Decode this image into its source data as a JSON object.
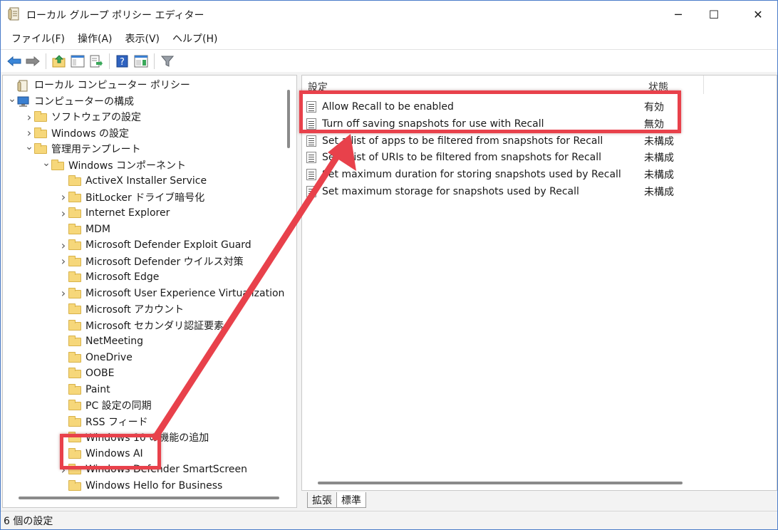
{
  "window": {
    "title": "ローカル グループ ポリシー エディター",
    "controls": {
      "minimize": "─",
      "maximize": "☐",
      "close": "✕"
    }
  },
  "menubar": [
    "ファイル(F)",
    "操作(A)",
    "表示(V)",
    "ヘルプ(H)"
  ],
  "toolbar": [
    "back-arrow-icon",
    "forward-arrow-icon",
    "up-folder-icon",
    "show-hide-tree-icon",
    "export-list-icon",
    "help-icon",
    "properties-icon",
    "filter-icon"
  ],
  "tree": [
    {
      "label": "ローカル コンピューター ポリシー",
      "level": 0,
      "chevron": "",
      "icon": "policy"
    },
    {
      "label": "コンピューターの構成",
      "level": 0,
      "chevron": "v",
      "icon": "computer"
    },
    {
      "label": "ソフトウェアの設定",
      "level": 1,
      "chevron": ">",
      "icon": "folder"
    },
    {
      "label": "Windows の設定",
      "level": 1,
      "chevron": ">",
      "icon": "folder"
    },
    {
      "label": "管理用テンプレート",
      "level": 1,
      "chevron": "v",
      "icon": "folder"
    },
    {
      "label": "Windows コンポーネント",
      "level": 2,
      "chevron": "v",
      "icon": "folder"
    },
    {
      "label": "ActiveX Installer Service",
      "level": 3,
      "chevron": "",
      "icon": "folder"
    },
    {
      "label": "BitLocker ドライブ暗号化",
      "level": 3,
      "chevron": ">",
      "icon": "folder"
    },
    {
      "label": "Internet Explorer",
      "level": 3,
      "chevron": ">",
      "icon": "folder"
    },
    {
      "label": "MDM",
      "level": 3,
      "chevron": "",
      "icon": "folder"
    },
    {
      "label": "Microsoft Defender Exploit Guard",
      "level": 3,
      "chevron": ">",
      "icon": "folder"
    },
    {
      "label": "Microsoft Defender ウイルス対策",
      "level": 3,
      "chevron": ">",
      "icon": "folder"
    },
    {
      "label": "Microsoft Edge",
      "level": 3,
      "chevron": "",
      "icon": "folder"
    },
    {
      "label": "Microsoft User Experience Virtualization",
      "level": 3,
      "chevron": ">",
      "icon": "folder"
    },
    {
      "label": "Microsoft アカウント",
      "level": 3,
      "chevron": "",
      "icon": "folder"
    },
    {
      "label": "Microsoft セカンダリ認証要素",
      "level": 3,
      "chevron": "",
      "icon": "folder"
    },
    {
      "label": "NetMeeting",
      "level": 3,
      "chevron": "",
      "icon": "folder"
    },
    {
      "label": "OneDrive",
      "level": 3,
      "chevron": "",
      "icon": "folder"
    },
    {
      "label": "OOBE",
      "level": 3,
      "chevron": "",
      "icon": "folder"
    },
    {
      "label": "Paint",
      "level": 3,
      "chevron": "",
      "icon": "folder"
    },
    {
      "label": "PC 設定の同期",
      "level": 3,
      "chevron": "",
      "icon": "folder"
    },
    {
      "label": "RSS フィード",
      "level": 3,
      "chevron": "",
      "icon": "folder"
    },
    {
      "label": "Windows 10 の機能の追加",
      "level": 3,
      "chevron": "",
      "icon": "folder"
    },
    {
      "label": "Windows AI",
      "level": 3,
      "chevron": "",
      "icon": "folder",
      "selected": true
    },
    {
      "label": "Windows Defender SmartScreen",
      "level": 3,
      "chevron": ">",
      "icon": "folder"
    },
    {
      "label": "Windows Hello for Business",
      "level": 3,
      "chevron": "",
      "icon": "folder"
    }
  ],
  "details": {
    "columns": {
      "setting": "設定",
      "state": "状態"
    },
    "rows": [
      {
        "name": "Allow Recall to be enabled",
        "state": "有効"
      },
      {
        "name": "Turn off saving snapshots for use with Recall",
        "state": "無効"
      },
      {
        "name": "Set a list of apps to be filtered from snapshots for Recall",
        "state": "未構成"
      },
      {
        "name": "Set a list of URIs to be filtered from snapshots for Recall",
        "state": "未構成"
      },
      {
        "name": "Set maximum duration for storing snapshots used by Recall",
        "state": "未構成"
      },
      {
        "name": "Set maximum storage for snapshots used by Recall",
        "state": "未構成"
      }
    ]
  },
  "tabs": [
    "拡張",
    "標準"
  ],
  "status": "6 個の設定",
  "colors": {
    "annotation": "#e8414b",
    "folder": "#f6d77a"
  }
}
